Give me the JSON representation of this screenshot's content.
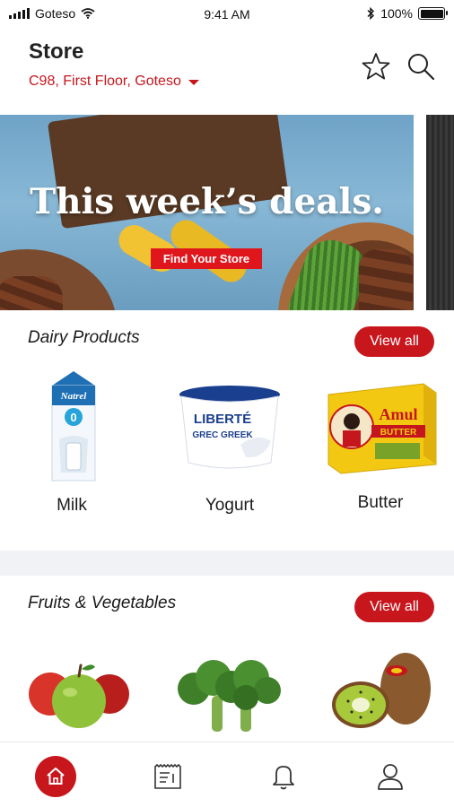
{
  "status_bar": {
    "carrier": "Goteso",
    "time": "9:41 AM",
    "battery": "100%"
  },
  "header": {
    "title": "Store",
    "address": "C98, First Floor, Goteso",
    "icons": [
      "star-icon",
      "search-icon"
    ]
  },
  "banner": {
    "headline": "This week’s deals.",
    "button_label": "Find Your Store"
  },
  "sections": [
    {
      "title": "Dairy Products",
      "view_all_label": "View all",
      "items": [
        {
          "label": "Milk",
          "brand": "Natrel",
          "badge": "0"
        },
        {
          "label": "Yogurt",
          "brand": "LIBERTÉ",
          "subtext": "GREC GREEK"
        },
        {
          "label": "Butter",
          "brand": "Amul",
          "subtext": "BUTTER"
        }
      ]
    },
    {
      "title": "Fruits & Vegetables",
      "view_all_label": "View all",
      "items": [
        {
          "label": "Apples"
        },
        {
          "label": "Broccoli"
        },
        {
          "label": "Kiwi"
        }
      ]
    }
  ],
  "bottom_nav": {
    "items": [
      "home-icon",
      "receipt-icon",
      "bell-icon",
      "profile-icon"
    ],
    "active": "home-icon"
  },
  "colors": {
    "accent": "#c8161d",
    "address": "#c4161c",
    "divider": "#f1f2f6"
  }
}
